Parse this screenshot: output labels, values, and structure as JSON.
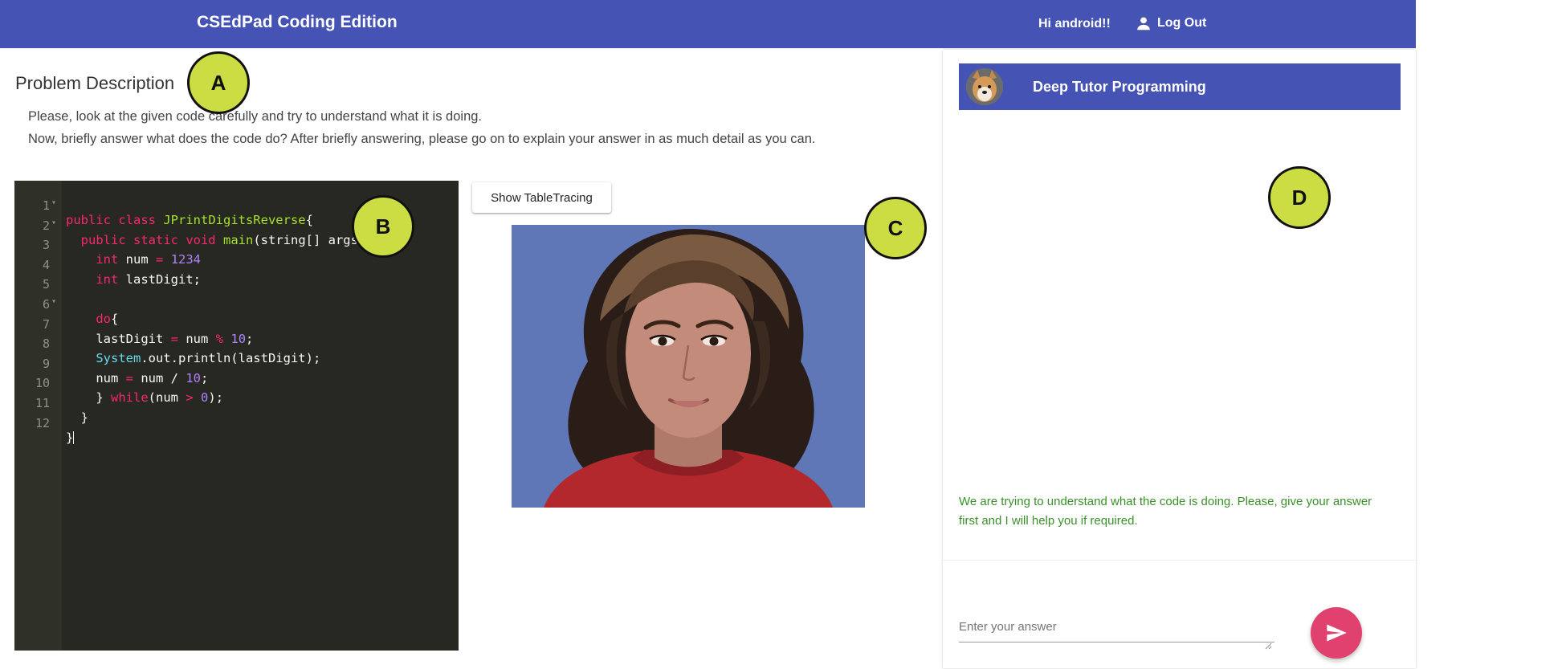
{
  "topbar": {
    "app_title": "CSEdPad Coding Edition",
    "greeting": "Hi android!!",
    "logout_label": "Log Out"
  },
  "problem": {
    "title": "Problem Description",
    "instruction_1": "Please, look at the given code carefully and try to understand what it is doing.",
    "instruction_2": "Now, briefly answer what does the code do? After briefly answering, please go on to explain your answer in as much detail as you can."
  },
  "editor": {
    "line_numbers": [
      "1",
      "2",
      "3",
      "4",
      "5",
      "6",
      "7",
      "8",
      "9",
      "10",
      "11",
      "12"
    ]
  },
  "controls": {
    "table_button_label": "Show TableTracing"
  },
  "chat": {
    "header_title": "Deep Tutor Programming",
    "message": "We are trying to understand what the code is doing. Please, give your answer first and I will help you if required.",
    "answer_placeholder": "Enter your answer"
  },
  "markers": {
    "a": "A",
    "b": "B",
    "c": "C",
    "d": "D"
  },
  "colors": {
    "primary": "#4553b5",
    "send_button": "#e0416e",
    "marker": "#ccdd44",
    "chat_message": "#3a8f2a",
    "editor_bg": "#272822"
  }
}
